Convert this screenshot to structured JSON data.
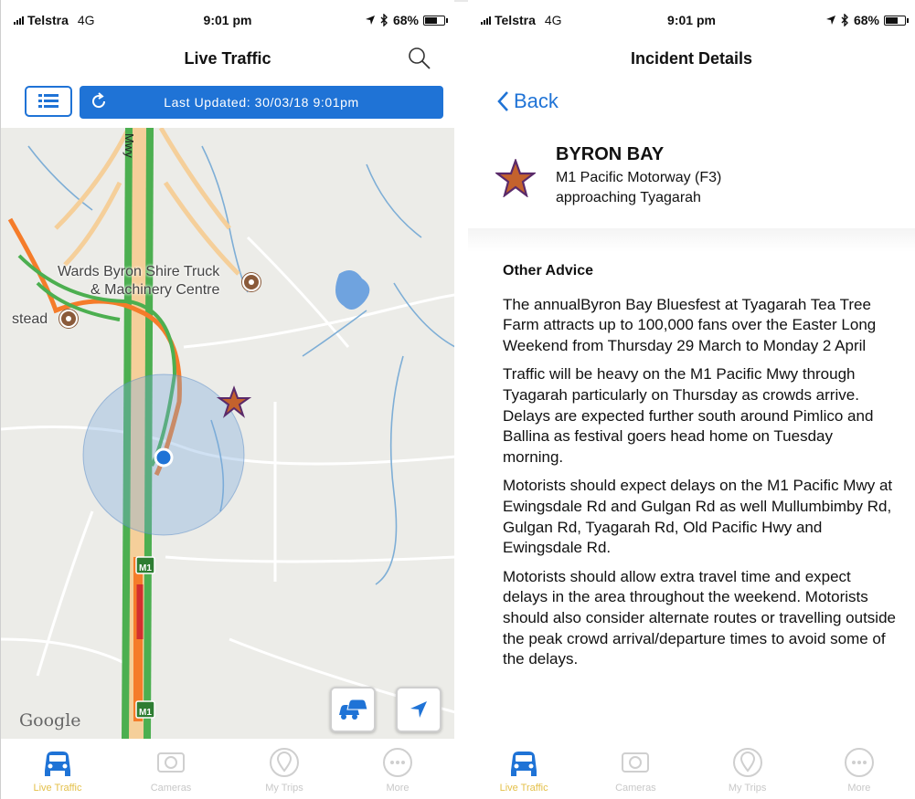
{
  "status_bar": {
    "carrier": "Telstra",
    "network": "4G",
    "time": "9:01 pm",
    "battery": "68%",
    "battery_level": 0.68
  },
  "left_screen": {
    "title": "Live Traffic",
    "last_updated": "Last Updated: 30/03/18 9:01pm",
    "map": {
      "road_label": "Mwy",
      "place_label_1": "Wards Byron Shire Truck",
      "place_label_2": "& Machinery Centre",
      "place_label_3": "stead",
      "shield_1": "M1",
      "shield_2": "M1",
      "attribution": "Google"
    }
  },
  "right_screen": {
    "title": "Incident Details",
    "back_label": "Back",
    "incident": {
      "location": "BYRON BAY",
      "road": "M1 Pacific Motorway (F3)",
      "direction": "approaching Tyagarah"
    },
    "advice_heading": "Other Advice",
    "paragraphs": [
      "The annualByron Bay Bluesfest at Tyagarah Tea Tree Farm attracts up to 100,000 fans over the Easter Long Weekend from Thursday 29 March to Monday 2 April",
      "Traffic will be heavy on the M1 Pacific Mwy through Tyagarah particularly on Thursday as crowds arrive. Delays are expected further south around Pimlico and Ballina as festival goers head home on Tuesday morning.",
      "Motorists should expect delays on the M1 Pacific Mwy at Ewingsdale Rd and Gulgan Rd as well Mullumbimby Rd, Gulgan Rd, Tyagarah Rd, Old Pacific Hwy and Ewingsdale Rd.",
      "Motorists should allow extra travel time and expect delays in the area throughout the weekend. Motorists should also consider alternate routes or travelling outside the peak crowd arrival/departure times to avoid some of the delays."
    ]
  },
  "tabs": [
    {
      "label": "Live Traffic",
      "icon": "car-icon",
      "active": true
    },
    {
      "label": "Cameras",
      "icon": "camera-icon",
      "active": false
    },
    {
      "label": "My Trips",
      "icon": "map-pin-icon",
      "active": false
    },
    {
      "label": "More",
      "icon": "more-icon",
      "active": false
    }
  ],
  "colors": {
    "accent": "#1f73d6",
    "road_green": "#4caf50",
    "road_orange": "#f57c2a",
    "road_red": "#d32f2f",
    "incident_star": "#c4622d"
  }
}
